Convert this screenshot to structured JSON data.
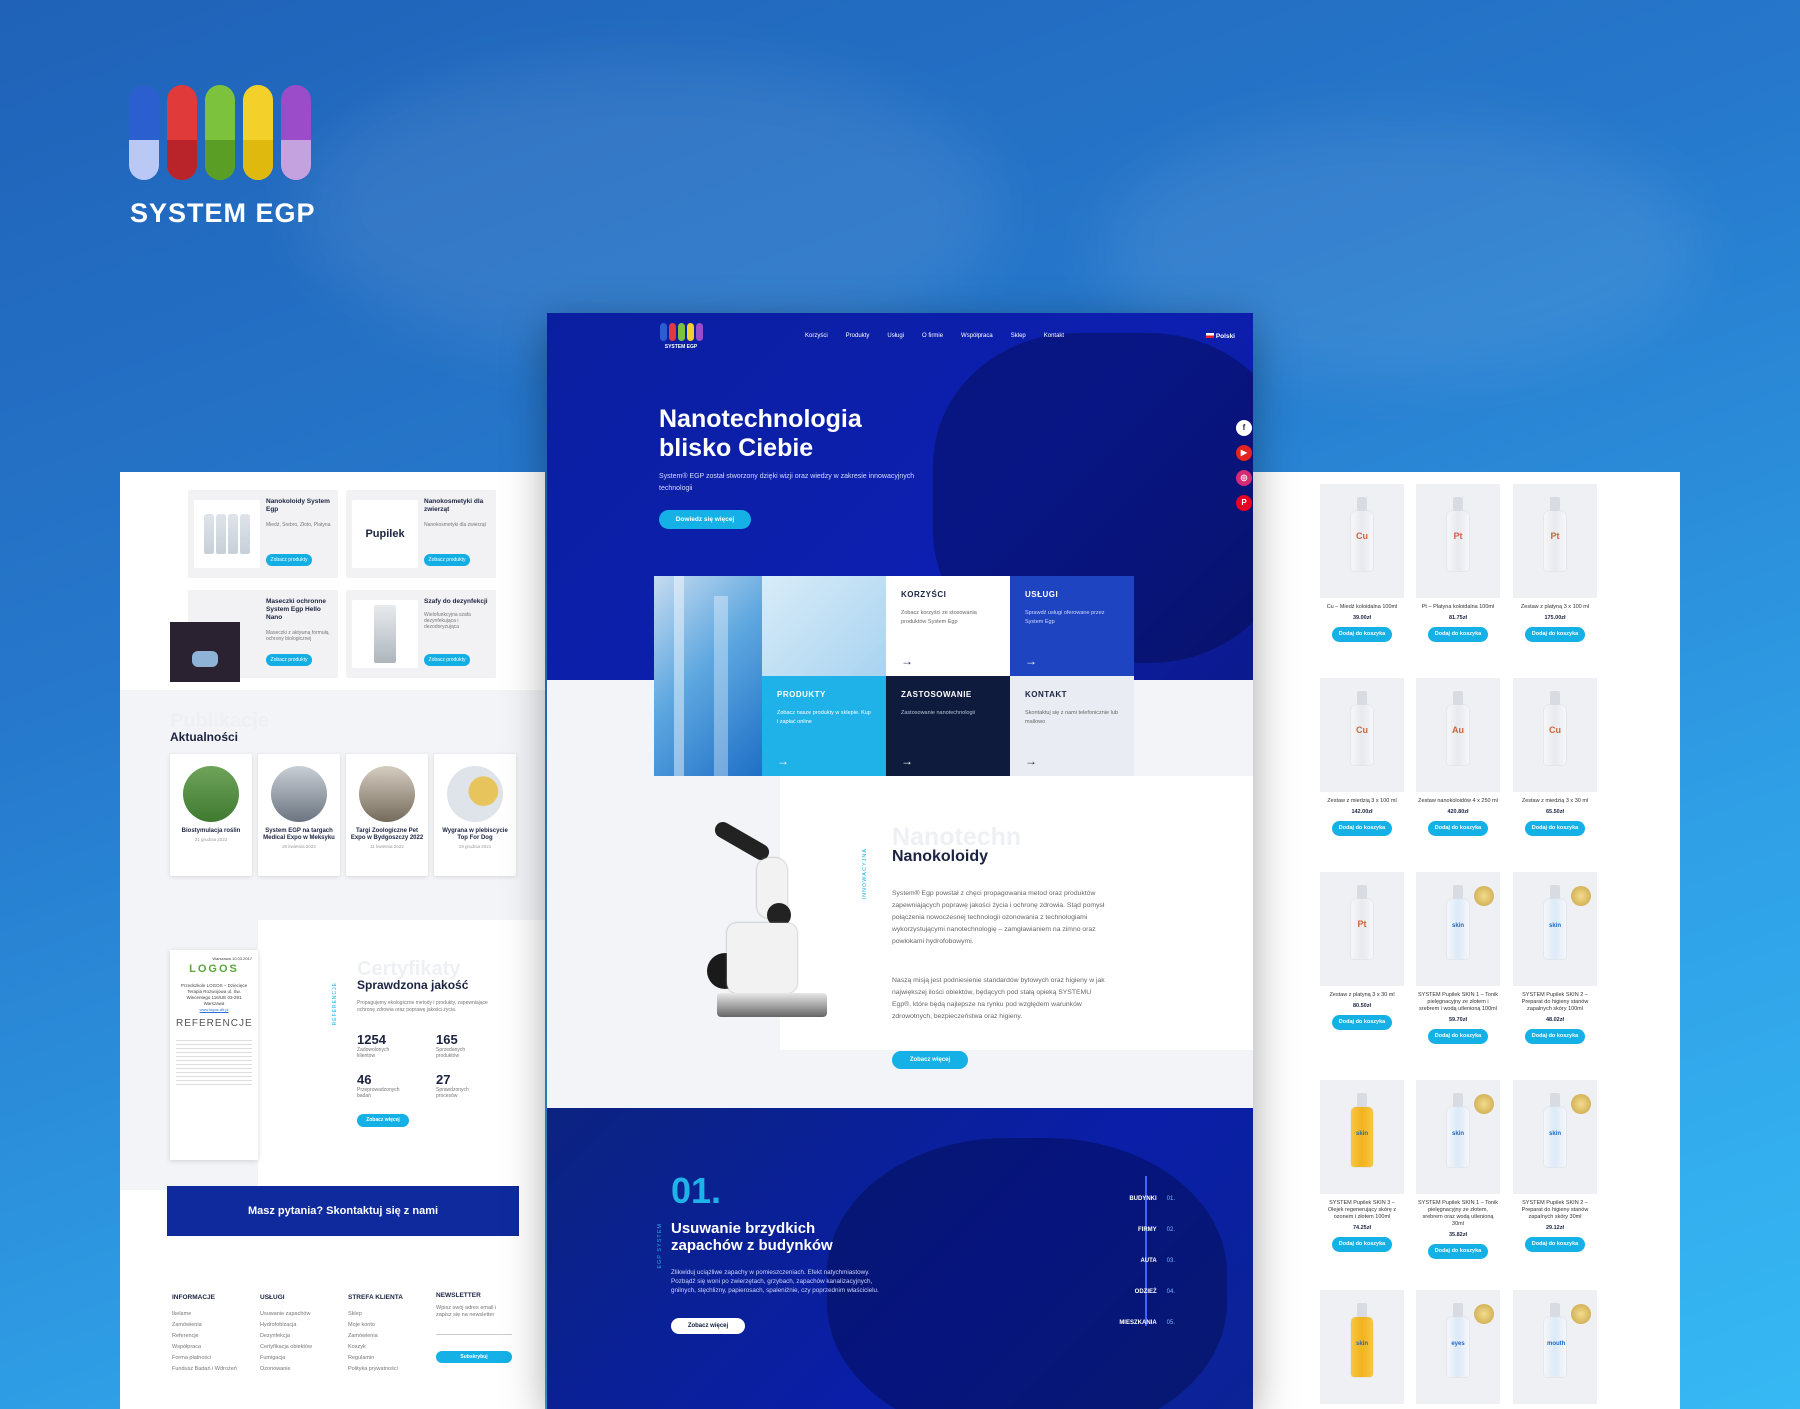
{
  "brand": {
    "name": "SYSTEM EGP",
    "capsule_colors": [
      "#2b5fd0",
      "#e03a3a",
      "#7cc23d",
      "#f4d12a",
      "#9b4cc8"
    ]
  },
  "left": {
    "products": [
      {
        "title": "Nanokoloidy System Egp",
        "desc": "Miedź, Srebro, Złoto, Platyna",
        "btn": "Zobacz produkty"
      },
      {
        "title": "Nanokosmetyki dla zwierząt",
        "desc": "Nanokosmetyki dla zwierząt",
        "btn": "Zobacz produkty",
        "brand": "Pupilek"
      },
      {
        "title": "Maseczki ochronne System Egp Hello Nano",
        "desc": "Maseczki z aktywną formułą ochrony biologicznej",
        "btn": "Zobacz produkty"
      },
      {
        "title": "Szafy do dezynfekcji",
        "desc": "Wielofunkcyjna szafa dezynfekująca i dezodoryzująca",
        "btn": "Zobacz produkty"
      }
    ],
    "news_ghost": "Publikacje",
    "news_title": "Aktualności",
    "news": [
      {
        "title": "Biostymulacja roślin",
        "date": "31 grudnia 2022"
      },
      {
        "title": "System EGP na targach Medical Expo w Meksyku",
        "date": "20 kwietnia 2022"
      },
      {
        "title": "Targi Zoologiczne Pet Expo w Bydgoszczy 2022",
        "date": "11 kwietnia 2022"
      },
      {
        "title": "Wygrana w plebiscycie Top For Dog",
        "date": "19 grudnia 2021"
      }
    ],
    "cert": {
      "ghost": "Certyfikaty",
      "title": "Sprawdzona jakość",
      "vertical": "REFERENCJE",
      "desc": "Propagujemy ekologiczne metody i produkty, zapewniające ochronę zdrowia oraz poprawę jakości życia.",
      "stats": [
        {
          "n": "1254",
          "l": "Zadowolonych klientów"
        },
        {
          "n": "165",
          "l": "Sprzedanych produktów"
        },
        {
          "n": "46",
          "l": "Przeprowadzonych badań"
        },
        {
          "n": "27",
          "l": "Sprawdzonych procesów"
        }
      ],
      "btn": "Zobacz więcej",
      "doc_heading": "LOGOS",
      "doc_title": "REFERENCJE",
      "doc_address": "Przedszkole LOGOS – Dziecięce Terapia Rozwojowa ul. Św. Wincentego 116/UE 03-291 Warszawa",
      "doc_site": "www.logos-dti.pl",
      "doc_date": "Warszawa 10.03.2017"
    },
    "cta": "Masz pytania? Skontaktuj się z nami",
    "footer": [
      {
        "h": "INFORMACJE",
        "items": [
          "Ikelame",
          "Zamówienia",
          "Referencje",
          "Współpraca",
          "Forma płatności",
          "Fundusz Badań i Wdrożeń"
        ]
      },
      {
        "h": "USŁUGI",
        "items": [
          "Usuwanie zapachów",
          "Hydrofobizacja",
          "Dezynfekcja",
          "Certyfikacja obiektów",
          "Fumigacja",
          "Ozonowanie"
        ]
      },
      {
        "h": "STREFA KLIENTA",
        "items": [
          "Sklep",
          "Moje konto",
          "Zamówienia",
          "Koszyk",
          "Regulamin",
          "Polityka prywatności"
        ]
      },
      {
        "h": "NEWSLETTER",
        "items": [
          "Wpisz swój adres email i zapisz się na newsletter"
        ],
        "btn": "Subskrybuj"
      }
    ]
  },
  "center": {
    "nav": {
      "logo": "SYSTEM EGP",
      "items": [
        "Korzyści",
        "Produkty",
        "Usługi",
        "O firmie",
        "Współpraca",
        "Sklep",
        "Kontakt"
      ],
      "lang": "Polski"
    },
    "hero": {
      "title": "Nanotechnologia blisko Ciebie",
      "text": "System® EGP został stworzony dzięki wizji oraz wiedzy w zakresie innowacyjnych technologii",
      "btn": "Dowiedz się więcej"
    },
    "social": [
      "f",
      "▶",
      "◎",
      "P"
    ],
    "tiles": [
      {
        "h": "KORZYŚCI",
        "t": "Zobacz korzyści ze stosowania produktów System Egp"
      },
      {
        "h": "USŁUGI",
        "t": "Sprawdź usługi oferowane przez System Egp"
      },
      {
        "h": "PRODUKTY",
        "t": "Zobacz nasze produkty w sklepie. Kup i zapłać online"
      },
      {
        "h": "ZASTOSOWANIE",
        "t": "Zastosowanie nanotechnologii"
      },
      {
        "h": "KONTAKT",
        "t": "Skontaktuj się z nami telefonicznie lub mailowo"
      }
    ],
    "arrow": "→",
    "nano": {
      "ghost": "Nanotechn",
      "title": "Nanokoloidy",
      "vertical": "INNOWACYJNA",
      "p1": "System® Egp powstał z chęci propagowania metod oraz produktów zapewniających poprawę jakości życia i ochronę zdrowia. Stąd pomysł połączenia nowoczesnej technologii ozonowania z technologiami wykorzystującymi nanotechnologię – zamgławianiem na zimno oraz powłokami hydrofobowymi.",
      "p2": "Naszą misją jest podniesienie standardów bytowych oraz higieny w jak największej ilości obiektów, będących pod stałą opieką SYSTEMU Egp®, które będą najlepsze na rynku pod względem warunków zdrowotnych, bezpieczeństwa oraz higieny.",
      "btn": "Zobacz więcej"
    },
    "services": {
      "num": "01.",
      "vertical": "EGP SYSTEM",
      "title": "Usuwanie brzydkich zapachów z budynków",
      "text": "Zlikwiduj uciążliwe zapachy w pomieszczeniach. Efekt natychmiastowy. Pozbądź się woni po zwierzętach, grzybach, zapachów kanalizacyjnych, gnilnych, stęchlizny, papierosach, spaleniźnie, czy poprzednim właścicielu.",
      "btn": "Zobacz więcej",
      "list": [
        {
          "l": "BUDYNKI",
          "n": "01."
        },
        {
          "l": "FIRMY",
          "n": "02."
        },
        {
          "l": "AUTA",
          "n": "03."
        },
        {
          "l": "ODZIEŻ",
          "n": "04."
        },
        {
          "l": "MIESZKANIA",
          "n": "05."
        }
      ]
    }
  },
  "right": {
    "btn": "Dodaj do koszyka",
    "products": [
      {
        "n": "Cu – Miedź koloidalna 100ml",
        "p": "39.00zł",
        "sym": "Cu"
      },
      {
        "n": "Pt – Platyna koloidalna 100ml",
        "p": "81.75zł",
        "sym": "Pt"
      },
      {
        "n": "Zestaw z platyną 3 x 100 ml",
        "p": "175.00zł",
        "sym": "Pt"
      },
      {
        "n": "Zestaw z miedzią 3 x 100 ml",
        "p": "142.00zł",
        "sym": "Cu"
      },
      {
        "n": "Zestaw nanokoloidów 4 x 250 ml",
        "p": "420.80zł",
        "sym": "Au"
      },
      {
        "n": "Zestaw z miedzią 3 x 30 ml",
        "p": "65.50zł",
        "sym": "Cu"
      },
      {
        "n": "Zestaw z platyną 3 x 30 ml",
        "p": "80.50zł",
        "sym": "Pt"
      },
      {
        "n": "SYSTEM Pupilek SKIN 1 – Tonik pielęgnacyjny ze złotem i srebrem i wodą utlenioną 100ml",
        "p": "59.70zł",
        "sym": "skin"
      },
      {
        "n": "SYSTEM Pupilek SKIN 2 – Preparat do higieny stanów zapalnych skóry 100ml",
        "p": "48.02zł",
        "sym": "skin"
      },
      {
        "n": "SYSTEM Pupilek SKIN 3 – Olejek regenerujący skórę z ozonem i złotem 100ml",
        "p": "74.25zł",
        "sym": "skin"
      },
      {
        "n": "SYSTEM Pupilek SKIN 1 – Tonik pielęgnacyjny ze złotem, srebrem oraz wodą utlenioną 30ml",
        "p": "35.82zł",
        "sym": "skin"
      },
      {
        "n": "SYSTEM Pupilek SKIN 2 – Preparat do higieny stanów zapalnych skóry 30ml",
        "p": "29.12zł",
        "sym": "skin"
      },
      {
        "n": "",
        "p": "",
        "sym": "skin"
      },
      {
        "n": "",
        "p": "",
        "sym": "eyes"
      },
      {
        "n": "",
        "p": "",
        "sym": "mouth"
      }
    ]
  }
}
